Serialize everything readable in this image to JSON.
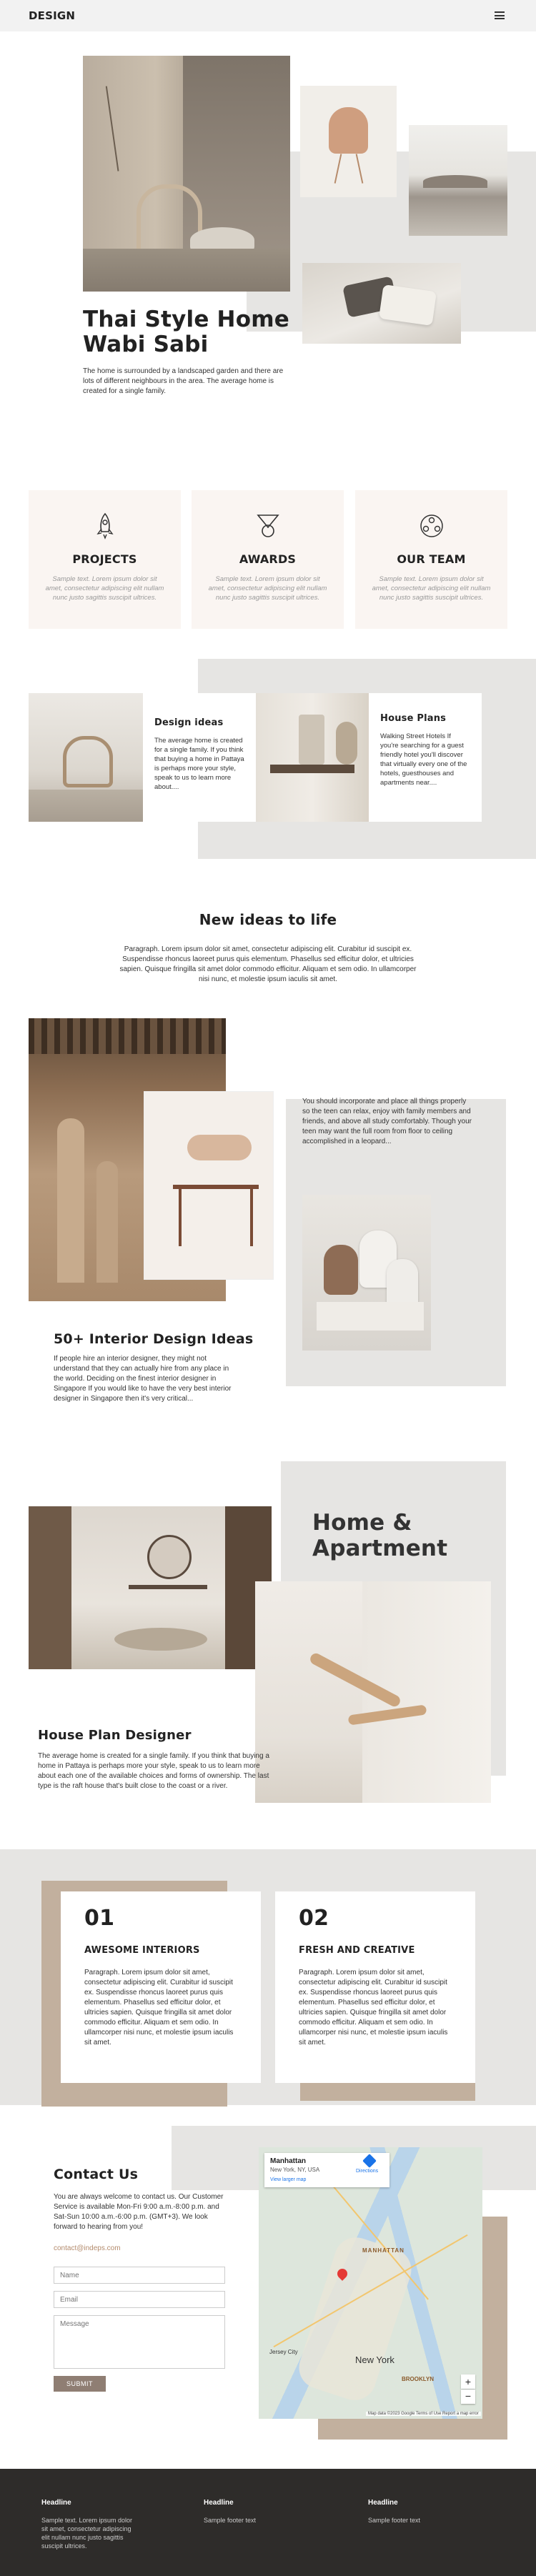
{
  "header": {
    "logo": "DESIGN"
  },
  "hero": {
    "title_line1": "Thai Style Home",
    "title_line2": "Wabi Sabi",
    "text": "The home is surrounded by a landscaped garden and there are lots of different neighbours in the area.  The average home is created for a single family."
  },
  "features": [
    {
      "icon": "rocket-icon",
      "title": "PROJECTS",
      "text": "Sample text. Lorem ipsum dolor sit amet, consectetur adipiscing elit nullam nunc justo sagittis suscipit ultrices."
    },
    {
      "icon": "medal-icon",
      "title": "AWARDS",
      "text": "Sample text. Lorem ipsum dolor sit amet, consectetur adipiscing elit nullam nunc justo sagittis suscipit ultrices."
    },
    {
      "icon": "team-icon",
      "title": "OUR TEAM",
      "text": "Sample text. Lorem ipsum dolor sit amet, consectetur adipiscing elit nullam nunc justo sagittis suscipit ultrices."
    }
  ],
  "ideas": {
    "card1_title": "Design ideas",
    "card1_text": "The average home is created for a single family. If you think that buying a home in Pattaya is perhaps more your style, speak to us to learn more about....",
    "card2_title": "House Plans",
    "card2_text": "Walking Street Hotels If you're searching for a guest friendly hotel you'll discover that virtually every one of the hotels, guesthouses and apartments near...."
  },
  "new_ideas": {
    "title": "New ideas to life",
    "text": "Paragraph. Lorem ipsum dolor sit amet, consectetur adipiscing elit. Curabitur id suscipit ex. Suspendisse rhoncus laoreet purus quis elementum. Phasellus sed efficitur dolor, et ultricies sapien. Quisque fringilla sit amet dolor commodo efficitur. Aliquam et sem odio. In ullamcorper nisi nunc, et molestie ipsum iaculis sit amet."
  },
  "interior": {
    "right_text": "You should incorporate and place all things properly so the teen can relax, enjoy with family members and friends, and above all study comfortably. Though your teen may want the full room from floor to ceiling accomplished in a leopard...",
    "title": "50+ Interior Design Ideas",
    "text": "If people hire an interior designer, they might not understand that they can actually hire from any place in the world. Deciding on the finest interior designer in Singapore If you would like to have the very best interior designer in Singapore then it's very critical..."
  },
  "home_apartment": {
    "title_line1": "Home &",
    "title_line2": "Apartment",
    "plan_title": "House Plan Designer",
    "plan_text": "The average home is created for a single family. If you think that buying a home in Pattaya is perhaps more your style, speak to us to learn more about each one of the available choices and forms of ownership. The last type is the raft house that's built close to the coast or a river."
  },
  "numbers": [
    {
      "number": "01",
      "title": "AWESOME INTERIORS",
      "text": "Paragraph. Lorem ipsum dolor sit amet, consectetur adipiscing elit. Curabitur id suscipit ex. Suspendisse rhoncus laoreet purus quis elementum. Phasellus sed efficitur dolor, et ultricies sapien. Quisque fringilla sit amet dolor commodo efficitur. Aliquam et sem odio. In ullamcorper nisi nunc, et molestie ipsum iaculis sit amet."
    },
    {
      "number": "02",
      "title": "FRESH AND CREATIVE",
      "text": "Paragraph. Lorem ipsum dolor sit amet, consectetur adipiscing elit. Curabitur id suscipit ex. Suspendisse rhoncus laoreet purus quis elementum. Phasellus sed efficitur dolor, et ultricies sapien. Quisque fringilla sit amet dolor commodo efficitur. Aliquam et sem odio. In ullamcorper nisi nunc, et molestie ipsum iaculis sit amet."
    }
  ],
  "contact": {
    "title": "Contact Us",
    "text": "You are always welcome to contact us. Our Customer Service is available Mon-Fri 9:00 a.m.-8:00 p.m. and Sat-Sun 10:00 a.m.-6:00 p.m. (GMT+3). We look forward to hearing from you!",
    "email": "contact@indeps.com",
    "name_placeholder": "Name",
    "email_placeholder": "Email",
    "message_placeholder": "Message",
    "submit": "SUBMIT"
  },
  "map": {
    "place": "Manhattan",
    "address": "New York, NY, USA",
    "directions": "Directions",
    "larger_map": "View larger map",
    "label_manhattan": "MANHATTAN",
    "label_new_york": "New York",
    "label_jersey": "Jersey City",
    "label_brooklyn": "BROOKLYN",
    "footer": "Map data ©2023 Google  Terms of Use  Report a map error"
  },
  "footer": [
    {
      "heading": "Headline",
      "text": "Sample text. Lorem ipsum dolor sit amet, consectetur adipiscing elit nullam nunc justo sagittis suscipit ultrices."
    },
    {
      "heading": "Headline",
      "text": "Sample footer text"
    },
    {
      "heading": "Headline",
      "text": "Sample footer text"
    }
  ],
  "colors": {
    "accent": "#c2b09e",
    "light_bg": "#faf5f2",
    "grey_bg": "#e6e5e3",
    "footer_bg": "#2e2c2a",
    "button": "#8f7e73"
  }
}
